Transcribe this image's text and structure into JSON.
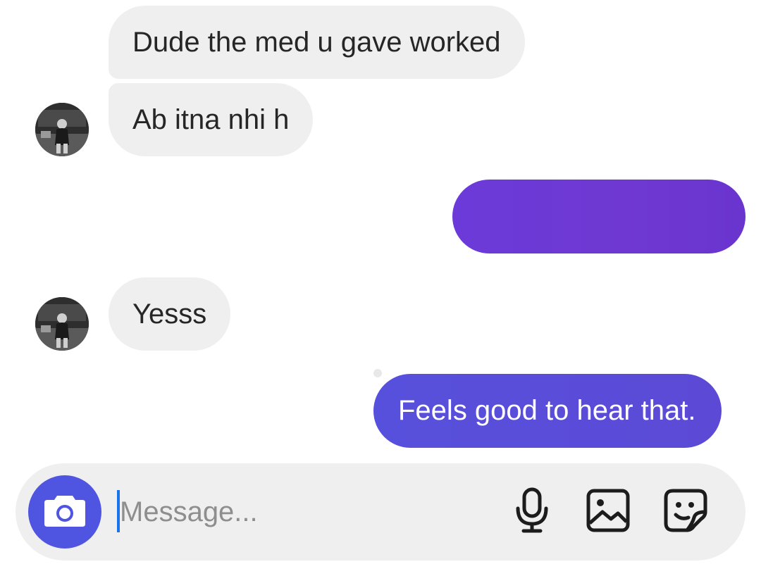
{
  "thread": {
    "messages": [
      {
        "direction": "incoming",
        "text": "Dude the med u gave worked"
      },
      {
        "direction": "incoming",
        "text": "Ab itna nhi h"
      },
      {
        "direction": "outgoing",
        "text": ""
      },
      {
        "direction": "incoming",
        "text": "Yesss"
      },
      {
        "direction": "outgoing",
        "text": "Feels good to hear that."
      }
    ]
  },
  "composer": {
    "placeholder": "Message...",
    "value": "",
    "icons": {
      "camera": "camera-icon",
      "mic": "microphone-icon",
      "gallery": "image-icon",
      "sticker": "sticker-icon"
    }
  },
  "colors": {
    "incoming_bubble": "#efefef",
    "outgoing_bubble": "#5b4ed8",
    "outgoing_redacted": "#6b38d6",
    "camera_button": "#4f55e0",
    "composer_bg": "#efefef"
  }
}
